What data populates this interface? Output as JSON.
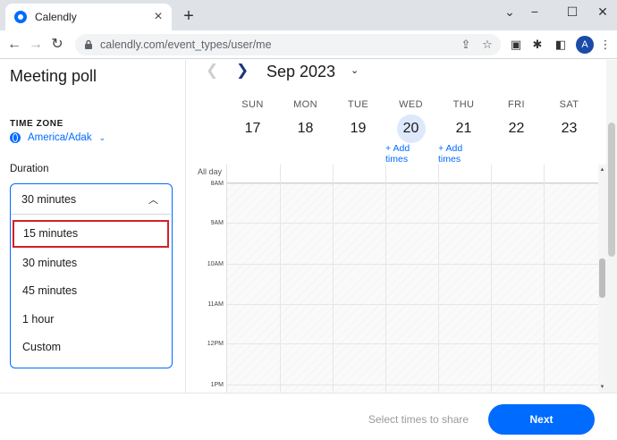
{
  "browser": {
    "tab_title": "Calendly",
    "url": "calendly.com/event_types/user/me",
    "avatar_letter": "A"
  },
  "left_panel": {
    "title": "Meeting poll",
    "timezone_label": "TIME ZONE",
    "timezone_value": "America/Adak",
    "duration_label": "Duration",
    "duration_selected": "30 minutes",
    "duration_options": [
      "15 minutes",
      "30 minutes",
      "45 minutes",
      "1 hour",
      "Custom"
    ]
  },
  "calendar": {
    "month": "Sep 2023",
    "days": [
      {
        "name": "SUN",
        "num": "17"
      },
      {
        "name": "MON",
        "num": "18"
      },
      {
        "name": "TUE",
        "num": "19"
      },
      {
        "name": "WED",
        "num": "20"
      },
      {
        "name": "THU",
        "num": "21"
      },
      {
        "name": "FRI",
        "num": "22"
      },
      {
        "name": "SAT",
        "num": "23"
      }
    ],
    "add_times_label_1": "+ Add",
    "add_times_label_2": "times",
    "all_day_label": "All day",
    "hours": [
      "8AM",
      "9AM",
      "10AM",
      "11AM",
      "12PM",
      "1PM"
    ]
  },
  "footer": {
    "hint": "Select times to share",
    "next_label": "Next"
  },
  "colors": {
    "accent": "#006bff",
    "highlight_border": "#d4202a",
    "today_bg": "#dde9fb"
  }
}
